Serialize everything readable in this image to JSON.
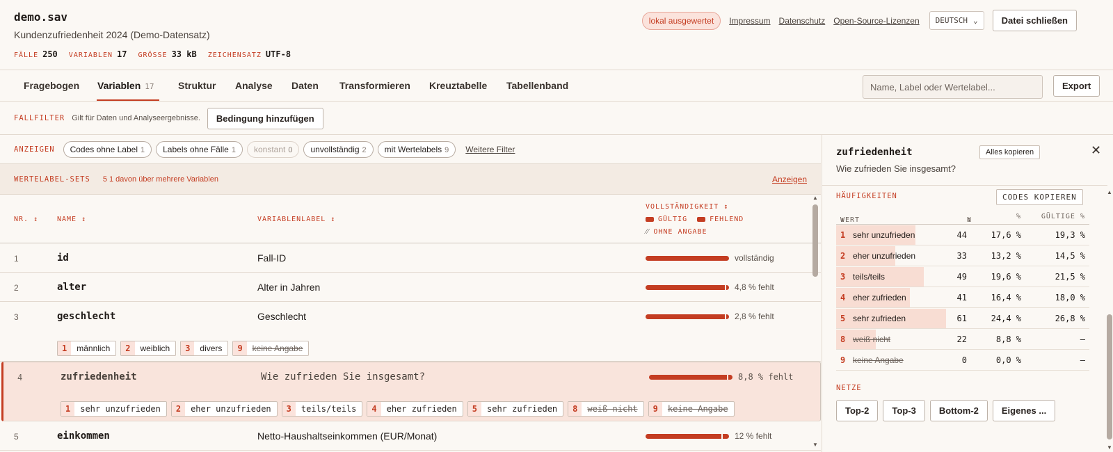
{
  "header": {
    "file": "demo.sav",
    "subtitle": "Kundenzufriedenheit 2024 (Demo-Datensatz)",
    "meta": [
      {
        "k": "FÄLLE",
        "v": "250"
      },
      {
        "k": "VARIABLEN",
        "v": "17"
      },
      {
        "k": "GRÖSSE",
        "v": "33 kB"
      },
      {
        "k": "ZEICHENSATZ",
        "v": "UTF-8"
      }
    ],
    "badge": "lokal ausgewertet",
    "links": [
      "Impressum",
      "Datenschutz",
      "Open-Source-Lizenzen"
    ],
    "language": "DEUTSCH",
    "close_button": "Datei schließen"
  },
  "tabs": [
    {
      "label": "Fragebogen"
    },
    {
      "label": "Variablen",
      "count": "17"
    },
    {
      "label": "Struktur"
    },
    {
      "label": "Analyse"
    },
    {
      "label": "Daten"
    },
    {
      "label": "Transformieren"
    },
    {
      "label": "Kreuztabelle"
    },
    {
      "label": "Tabellenband"
    }
  ],
  "search": {
    "placeholder": "Name, Label oder Wertelabel..."
  },
  "export_label": "Export",
  "filter": {
    "label": "FALLFILTER",
    "hint": "Gilt für Daten und Analyseergebnisse.",
    "button": "Bedingung hinzufügen"
  },
  "show": {
    "label": "ANZEIGEN",
    "chips": [
      {
        "label": "Codes ohne Label",
        "n": "1"
      },
      {
        "label": "Labels ohne Fälle",
        "n": "1"
      },
      {
        "label": "konstant",
        "n": "0"
      },
      {
        "label": "unvollständig",
        "n": "2"
      },
      {
        "label": "mit Wertelabels",
        "n": "9"
      }
    ],
    "more": "Weitere Filter"
  },
  "wertelabel": {
    "label": "WERTELABEL-SETS",
    "text": "5  1 davon über mehrere Variablen",
    "link": "Anzeigen"
  },
  "table": {
    "headers": {
      "nr": "NR.",
      "name": "NAME",
      "label": "VARIABLENLABEL",
      "completeness": "VOLLSTÄNDIGKEIT",
      "valid": "GÜLTIG",
      "missing": "FEHLEND",
      "noanswer": "OHNE ANGABE"
    },
    "rows": [
      {
        "nr": "1",
        "name": "id",
        "label": "Fall-ID",
        "valid": 1.0,
        "missing": 0,
        "stat": "vollständig",
        "codes": []
      },
      {
        "nr": "2",
        "name": "alter",
        "label": "Alter in Jahren",
        "valid": 0.952,
        "missing": 0.048,
        "stat": "4,8 % fehlt",
        "codes": []
      },
      {
        "nr": "3",
        "name": "geschlecht",
        "label": "Geschlecht",
        "valid": 0.972,
        "missing": 0.028,
        "stat": "2,8 % fehlt",
        "codes": [
          {
            "c": "1",
            "l": "männlich"
          },
          {
            "c": "2",
            "l": "weiblich"
          },
          {
            "c": "3",
            "l": "divers"
          },
          {
            "c": "9",
            "l": "keine Angabe",
            "miss": true
          }
        ]
      },
      {
        "nr": "4",
        "name": "zufriedenheit",
        "label": "Wie zufrieden Sie insgesamt?",
        "valid": 0.912,
        "missing": 0.088,
        "stat": "8,8 % fehlt",
        "codes": [
          {
            "c": "1",
            "l": "sehr unzufrieden"
          },
          {
            "c": "2",
            "l": "eher unzufrieden"
          },
          {
            "c": "3",
            "l": "teils/teils"
          },
          {
            "c": "4",
            "l": "eher zufrieden"
          },
          {
            "c": "5",
            "l": "sehr zufrieden"
          },
          {
            "c": "8",
            "l": "weiß nicht",
            "miss": true
          },
          {
            "c": "9",
            "l": "keine Angabe",
            "miss": true
          }
        ]
      },
      {
        "nr": "5",
        "name": "einkommen",
        "label": "Netto-Haushaltseinkommen (EUR/Monat)",
        "valid": 0.88,
        "missing": 0.12,
        "stat": "12 % fehlt",
        "codes": []
      }
    ]
  },
  "panel": {
    "title": "zufriedenheit",
    "copy_all": "Alles kopieren",
    "question": "Wie zufrieden Sie insgesamt?",
    "freq_label": "HÄUFIGKEITEN",
    "copy_codes": "CODES KOPIEREN",
    "freq_headers": {
      "value": "WERT",
      "n": "N",
      "pct": "%",
      "valid": "GÜLTIGE %"
    },
    "freq_rows": [
      {
        "c": "1",
        "l": "sehr unzufrieden",
        "n": "44",
        "p": "17,6 %",
        "g": "19,3 %",
        "share": 0.72
      },
      {
        "c": "2",
        "l": "eher unzufrieden",
        "n": "33",
        "p": "13,2 %",
        "g": "14,5 %",
        "share": 0.54
      },
      {
        "c": "3",
        "l": "teils/teils",
        "n": "49",
        "p": "19,6 %",
        "g": "21,5 %",
        "share": 0.8
      },
      {
        "c": "4",
        "l": "eher zufrieden",
        "n": "41",
        "p": "16,4 %",
        "g": "18,0 %",
        "share": 0.67
      },
      {
        "c": "5",
        "l": "sehr zufrieden",
        "n": "61",
        "p": "24,4 %",
        "g": "26,8 %",
        "share": 1.0
      },
      {
        "c": "8",
        "l": "weiß nicht",
        "n": "22",
        "p": "8,8 %",
        "g": "–",
        "share": 0.36,
        "miss": true
      },
      {
        "c": "9",
        "l": "keine Angabe",
        "n": "0",
        "p": "0,0 %",
        "g": "–",
        "share": 0,
        "miss": true
      }
    ],
    "netze_label": "NETZE",
    "netze": [
      "Top-2",
      "Top-3",
      "Bottom-2",
      "Eigenes ..."
    ]
  },
  "colors": {
    "accent": "#c43d22",
    "bg": "#fbf8f4",
    "selected_row": "#f9e4dc"
  }
}
